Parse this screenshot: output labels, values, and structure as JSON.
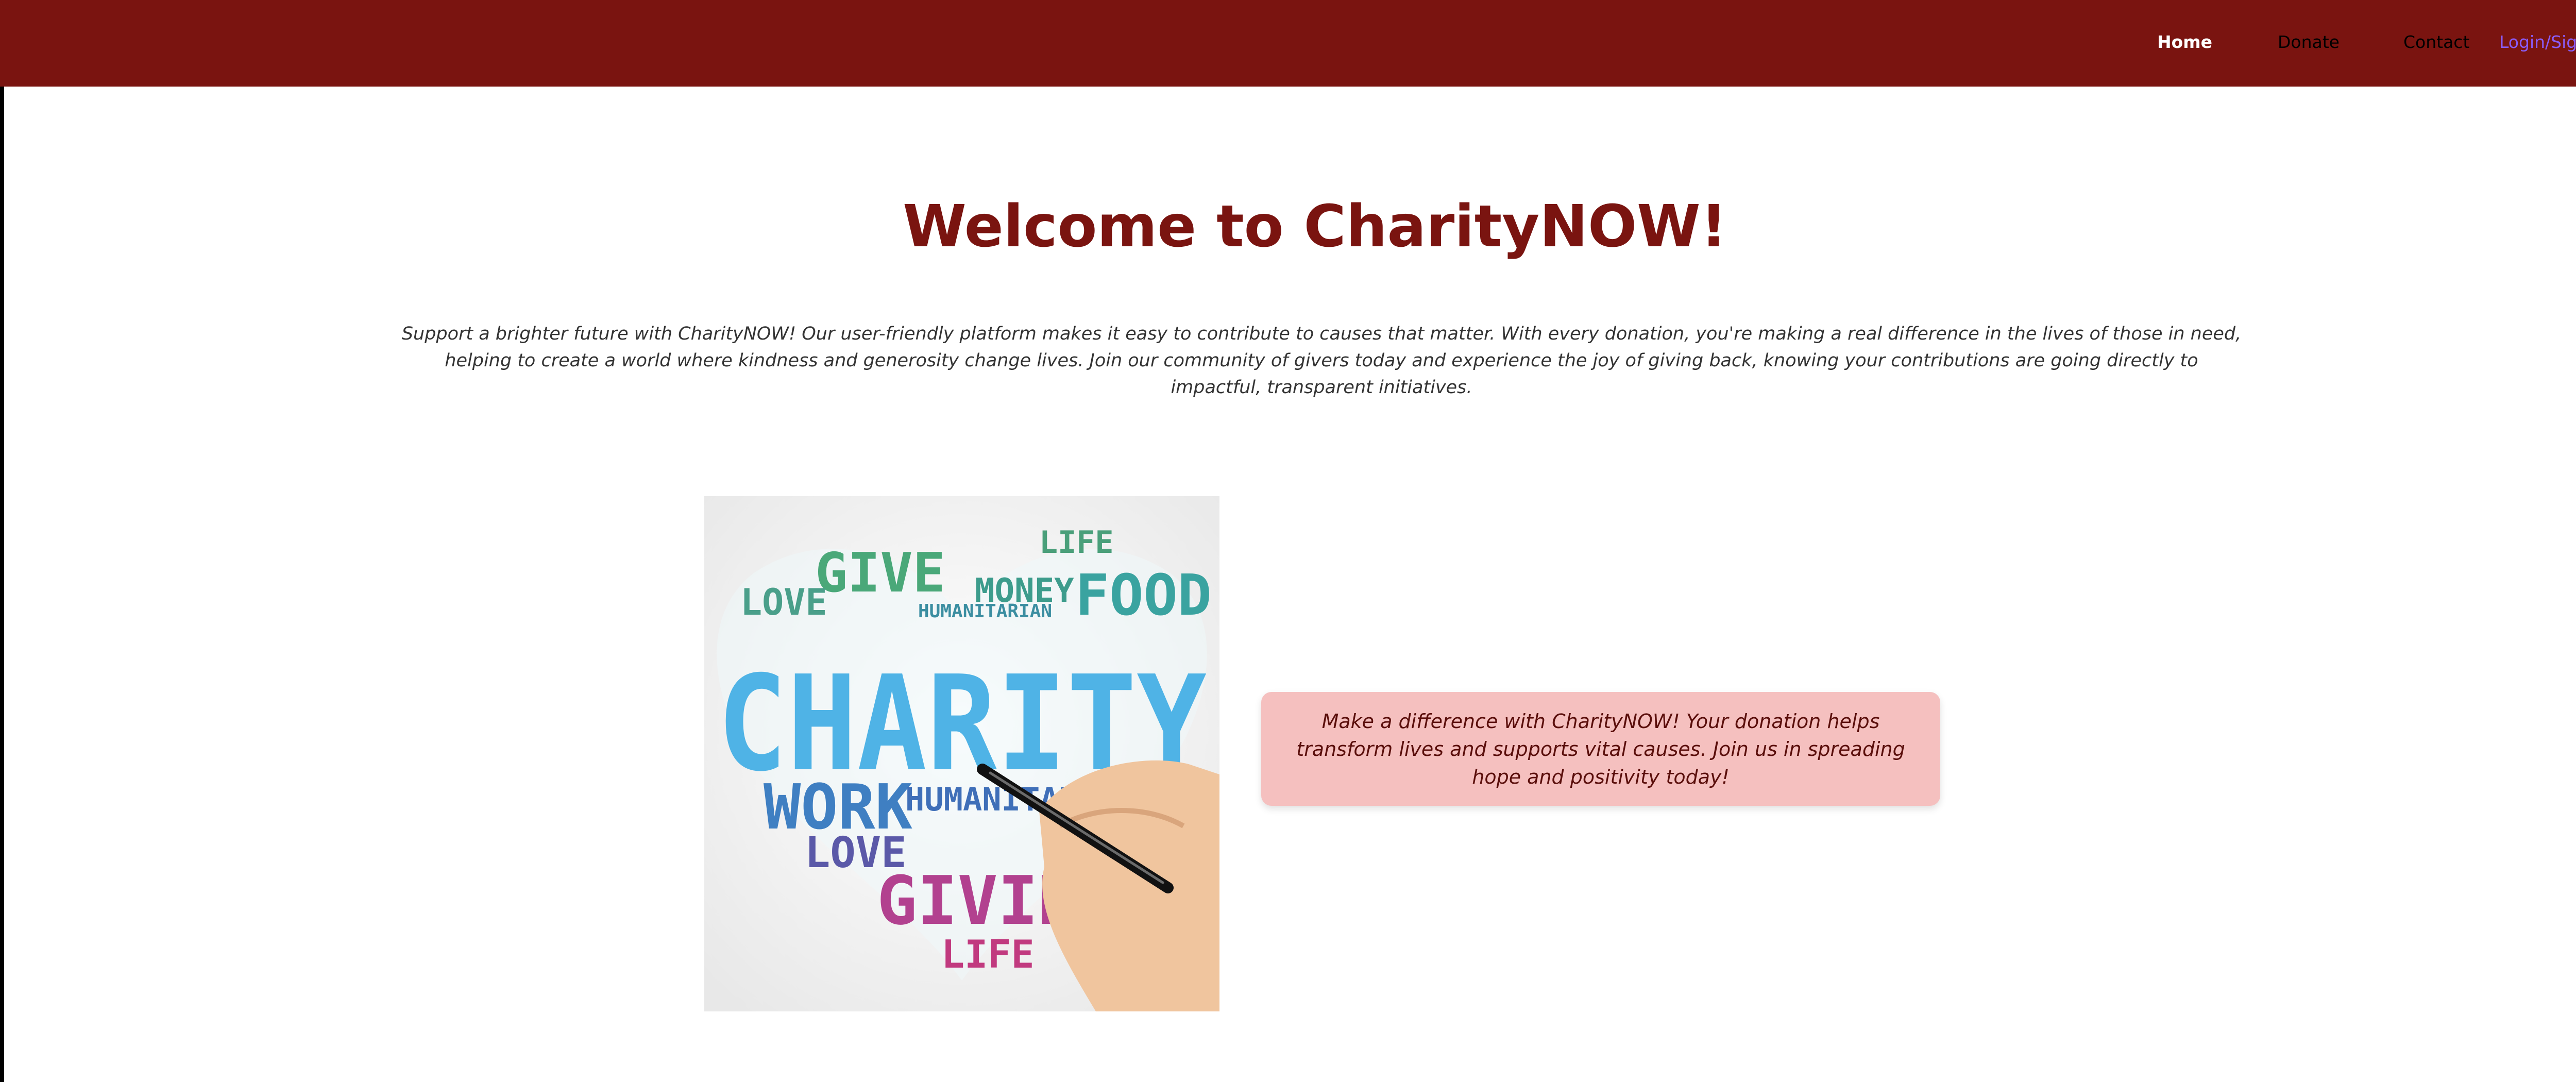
{
  "nav": {
    "items": [
      {
        "label": "Home"
      },
      {
        "label": "Donate"
      },
      {
        "label": "Contact"
      },
      {
        "label": "Login/Sign Up"
      }
    ]
  },
  "main": {
    "title": "Welcome to CharityNOW!",
    "intro": "Support a brighter future with CharityNOW! Our user-friendly platform makes it easy to contribute to causes that matter. With every donation, you're making a real difference in the lives of those in need, helping to create a world where kindness and generosity change lives. Join our community of givers today and experience the joy of giving back, knowing your contributions are going directly to impactful, transparent initiatives.",
    "callout": "Make a difference with CharityNOW! Your donation helps transform lives and supports vital causes. Join us in spreading hope and positivity today!"
  },
  "hero_image": {
    "words": {
      "charity": "CHARITY",
      "give": "GIVE",
      "love": "LOVE",
      "money": "MONEY",
      "food": "FOOD",
      "humanitarian": "HUMANITARIAN",
      "work": "WORK",
      "giving": "GIVING",
      "life": "LIFE"
    }
  },
  "colors": {
    "brand": "#7a1410",
    "nav_link_accent": "#8a5cf6",
    "callout_bg": "#f5c0bf"
  }
}
